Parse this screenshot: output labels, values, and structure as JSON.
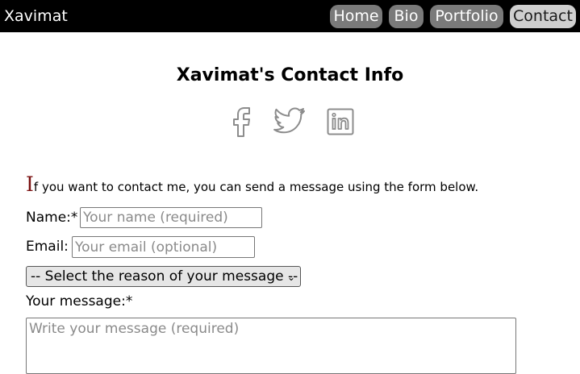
{
  "header": {
    "brand": "Xavimat",
    "nav": [
      {
        "label": "Home",
        "active": false
      },
      {
        "label": "Bio",
        "active": false
      },
      {
        "label": "Portfolio",
        "active": false
      },
      {
        "label": "Contact",
        "active": true
      }
    ]
  },
  "main": {
    "title": "Xavimat's Contact Info",
    "social": [
      "facebook-icon",
      "twitter-icon",
      "linkedin-icon"
    ],
    "intro_dropcap": "I",
    "intro_rest": "f you want to contact me, you can send a message using the form below."
  },
  "form": {
    "name_label": "Name:*",
    "name_placeholder": "Your name (required)",
    "email_label": "Email:",
    "email_placeholder": "Your email (optional)",
    "reason_selected": "-- Select the reason of your message --",
    "message_label": "Your message:*",
    "message_placeholder": "Write your message (required)"
  },
  "colors": {
    "header_bg": "#000000",
    "nav_button": "#7a7a7a",
    "nav_active": "#cfcfcf",
    "dropcap": "#7a1010",
    "icon_stroke": "#8c8c8c"
  }
}
